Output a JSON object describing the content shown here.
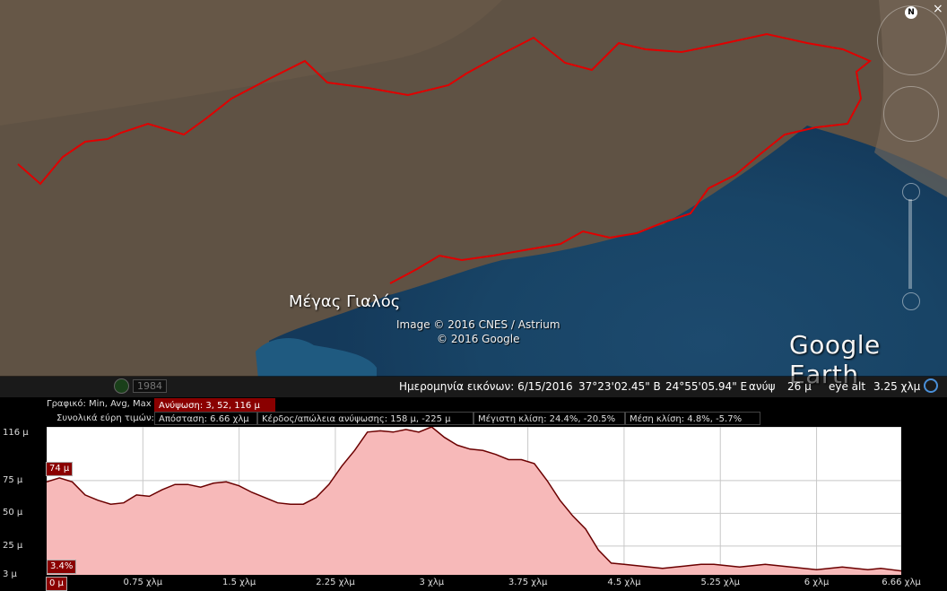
{
  "map": {
    "place_name": "Μέγας Γιαλός",
    "credit_line1": "Image © 2016 CNES / Astrium",
    "credit_line2": "© 2016 Google",
    "logo": "Google Earth",
    "compass_n": "N",
    "history_year": "1984",
    "status": {
      "imagery_date": "Ημερομηνία εικόνων: 6/15/2016",
      "lat": "37°23'02.45\" Β",
      "lon": "24°55'05.94\" Ε",
      "elev_label": "ανύψ",
      "elev_value": "26 μ",
      "eye_label": "eye alt",
      "eye_value": "3.25 χλμ"
    },
    "colors": {
      "track": "#e00000",
      "sea": "#184466",
      "land": "#5e5142"
    }
  },
  "panel": {
    "close": "×",
    "graph_label": "Γραφικό: Min, Avg, Max",
    "graph_value": "Ανύψωση: 3, 52, 116 μ",
    "totals_label": "Συνολικά εύρη τιμών:",
    "distance": "Απόσταση: 6.66 χλμ",
    "gain_loss": "Κέρδος/απώλεια ανύψωσης: 158 μ, -225 μ",
    "max_slope": "Μέγιστη κλίση: 24.4%, -20.5%",
    "avg_slope": "Μέση κλίση: 4.8%, -5.7%",
    "cursor_elev": "74 μ",
    "cursor_slope": "3.4%",
    "cursor_x": "0 μ"
  },
  "chart_data": {
    "type": "area",
    "ylabel": "",
    "xlabel": "",
    "y_ticks": [
      "116 μ",
      "75 μ",
      "50 μ",
      "25 μ",
      "3 μ"
    ],
    "y_tick_values": [
      116,
      75,
      50,
      25,
      3
    ],
    "x_ticks": [
      "0 μ",
      "0.75 χλμ",
      "1.5 χλμ",
      "2.25 χλμ",
      "3 χλμ",
      "3.75 χλμ",
      "4.5 χλμ",
      "5.25 χλμ",
      "6 χλμ",
      "6.66 χλμ"
    ],
    "x_tick_values": [
      0,
      0.75,
      1.5,
      2.25,
      3,
      3.75,
      4.5,
      5.25,
      6,
      6.66
    ],
    "ylim": [
      3,
      116
    ],
    "xlim": [
      0,
      6.66
    ],
    "grid": true,
    "series": [
      {
        "color": "#6b0000",
        "fill": "#f7b9b9",
        "x": [
          0,
          0.1,
          0.2,
          0.3,
          0.4,
          0.5,
          0.6,
          0.7,
          0.8,
          0.9,
          1.0,
          1.1,
          1.2,
          1.3,
          1.4,
          1.5,
          1.6,
          1.7,
          1.8,
          1.9,
          2.0,
          2.1,
          2.2,
          2.3,
          2.4,
          2.5,
          2.6,
          2.7,
          2.8,
          2.9,
          3.0,
          3.1,
          3.2,
          3.3,
          3.4,
          3.5,
          3.6,
          3.7,
          3.8,
          3.9,
          4.0,
          4.1,
          4.2,
          4.3,
          4.4,
          4.5,
          4.6,
          4.7,
          4.8,
          4.9,
          5.0,
          5.1,
          5.2,
          5.3,
          5.4,
          5.5,
          5.6,
          5.7,
          5.8,
          5.9,
          6.0,
          6.1,
          6.2,
          6.3,
          6.4,
          6.5,
          6.66
        ],
        "y": [
          74,
          77,
          74,
          64,
          60,
          57,
          58,
          64,
          63,
          68,
          72,
          72,
          70,
          73,
          74,
          71,
          66,
          62,
          58,
          57,
          57,
          62,
          72,
          86,
          98,
          112,
          113,
          112,
          114,
          112,
          116,
          108,
          102,
          99,
          98,
          95,
          91,
          91,
          88,
          75,
          60,
          48,
          38,
          22,
          12,
          11,
          10,
          9,
          8,
          9,
          10,
          11,
          11,
          10,
          9,
          10,
          11,
          10,
          9,
          8,
          7,
          8,
          9,
          8,
          7,
          8,
          6
        ]
      }
    ]
  }
}
